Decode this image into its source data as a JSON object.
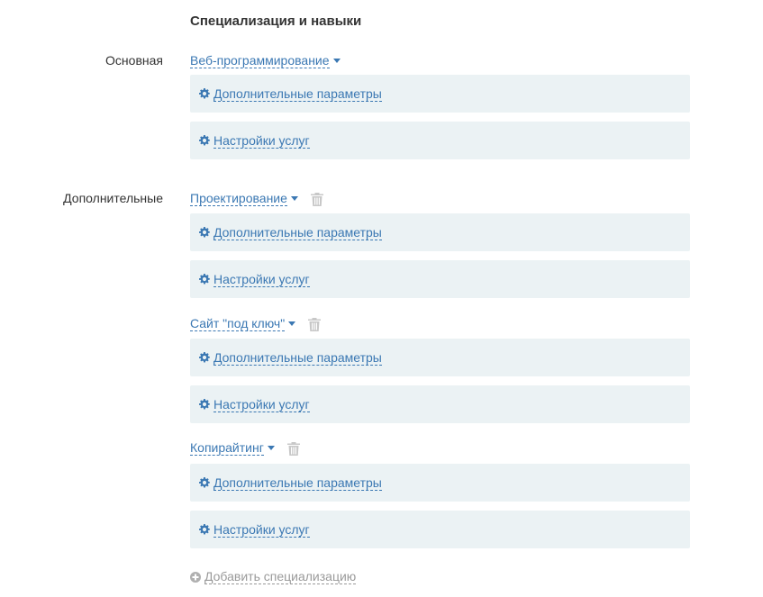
{
  "section_title": "Специализация и навыки",
  "primary_label": "Основная",
  "additional_label": "Дополнительные",
  "primary": {
    "name": "Веб-программирование",
    "extra_params": "Дополнительные параметры",
    "service_settings": "Настройки услуг"
  },
  "additional": [
    {
      "name": "Проектирование",
      "extra_params": "Дополнительные параметры",
      "service_settings": "Настройки услуг"
    },
    {
      "name": "Сайт \"под ключ\"",
      "extra_params": "Дополнительные параметры",
      "service_settings": "Настройки услуг"
    },
    {
      "name": "Копирайтинг",
      "extra_params": "Дополнительные параметры",
      "service_settings": "Настройки услуг"
    }
  ],
  "add_specialization": "Добавить специализацию",
  "colors": {
    "link": "#3b78b3",
    "panel_bg": "#ebf2f4",
    "muted": "#9a9a9a",
    "trash": "#c8c8c8"
  },
  "icons": {
    "dropdown": "caret-down-icon",
    "settings": "gear-icon",
    "delete": "trash-icon",
    "add": "plus-circle-icon"
  }
}
